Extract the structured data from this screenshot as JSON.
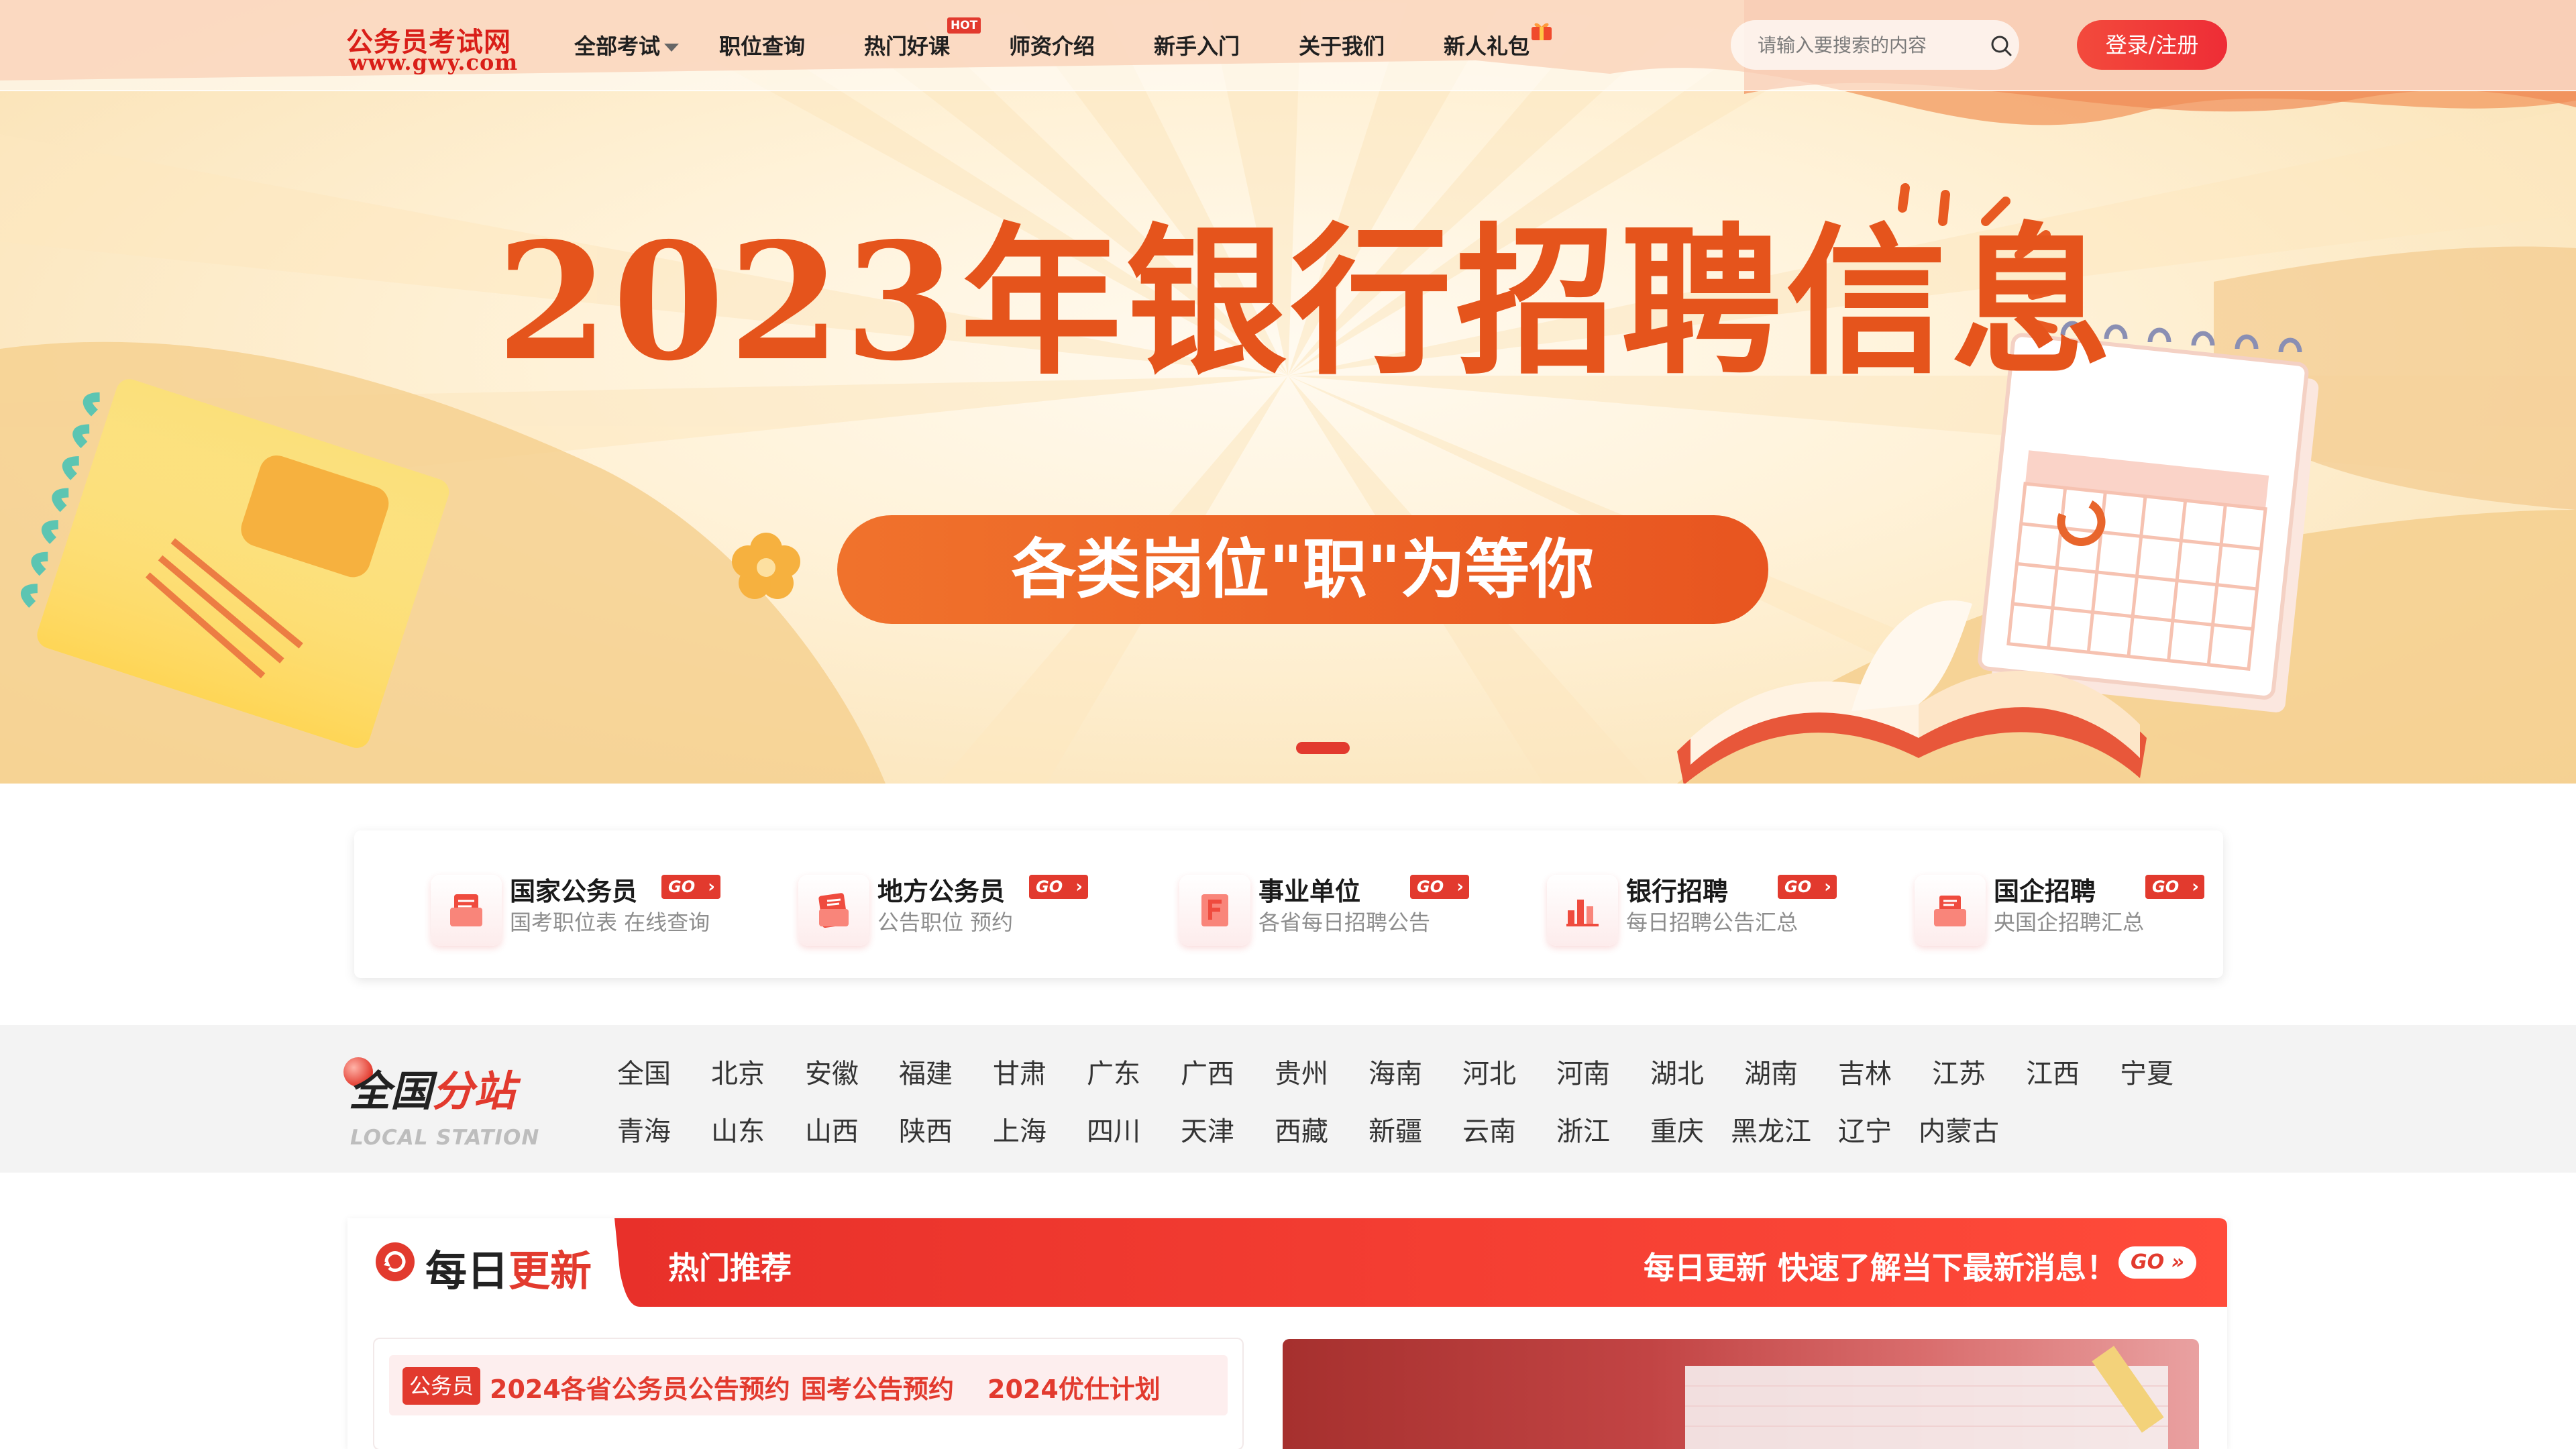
{
  "nav": {
    "logo_cn": "公务员考试网",
    "logo_en": "www.gwy.com",
    "items": [
      {
        "label": "全部考试",
        "has_dropdown": true
      },
      {
        "label": "职位查询"
      },
      {
        "label": "热门好课",
        "badge": "HOT"
      },
      {
        "label": "师资介绍"
      },
      {
        "label": "新手入门"
      },
      {
        "label": "关于我们"
      },
      {
        "label": "新人礼包",
        "icon": "gift-icon"
      }
    ],
    "search_placeholder": "请输入要搜索的内容",
    "login_label": "登录/注册"
  },
  "hero": {
    "title": "2023年银行招聘信息",
    "subtitle": "各类岗位\"职\"为等你",
    "active_slide": 1
  },
  "categories": [
    {
      "title": "国家公务员",
      "desc": "国考职位表 在线查询",
      "go": "GO",
      "icon": "document-icon"
    },
    {
      "title": "地方公务员",
      "desc": "公告职位 预约",
      "go": "GO",
      "icon": "notepad-icon"
    },
    {
      "title": "事业单位",
      "desc": "各省每日招聘公告",
      "go": "GO",
      "icon": "certificate-icon"
    },
    {
      "title": "银行招聘",
      "desc": "每日招聘公告汇总",
      "go": "GO",
      "icon": "bank-chart-icon"
    },
    {
      "title": "国企招聘",
      "desc": "央国企招聘汇总",
      "go": "GO",
      "icon": "briefcase-icon"
    }
  ],
  "stations": {
    "title_a": "全国",
    "title_b": "分站",
    "subtitle": "LOCAL STATION",
    "row1": [
      "全国",
      "北京",
      "安徽",
      "福建",
      "甘肃",
      "广东",
      "广西",
      "贵州",
      "海南",
      "河北",
      "河南",
      "湖北",
      "湖南",
      "吉林",
      "江苏",
      "江西",
      "宁夏"
    ],
    "row2": [
      "青海",
      "山东",
      "山西",
      "陕西",
      "上海",
      "四川",
      "天津",
      "西藏",
      "新疆",
      "云南",
      "浙江",
      "重庆",
      "黑龙江",
      "辽宁",
      "内蒙古"
    ]
  },
  "daily": {
    "title_a": "每日",
    "title_b": "更新",
    "hot_label": "热门推荐",
    "slogan": "每日更新 快速了解当下最新消息！",
    "go": "GO »",
    "tag": "公务员",
    "links": [
      "2024各省公务员公告预约",
      "国考公告预约",
      "2024优仕计划"
    ]
  },
  "colors": {
    "brand_red": "#e23a2e",
    "hero_orange": "#e5541c",
    "muted_text": "#8d8d8d"
  }
}
